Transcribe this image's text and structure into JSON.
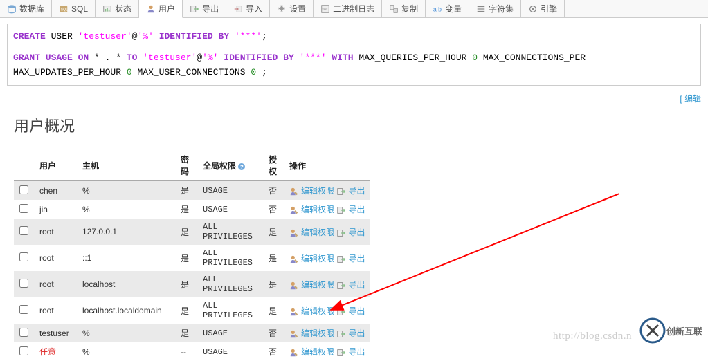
{
  "tabs": [
    {
      "label": "数据库",
      "icon": "database-icon"
    },
    {
      "label": "SQL",
      "icon": "sql-icon"
    },
    {
      "label": "状态",
      "icon": "status-icon"
    },
    {
      "label": "用户",
      "icon": "users-icon",
      "active": true
    },
    {
      "label": "导出",
      "icon": "export-icon"
    },
    {
      "label": "导入",
      "icon": "import-icon"
    },
    {
      "label": "设置",
      "icon": "settings-icon"
    },
    {
      "label": "二进制日志",
      "icon": "binlog-icon"
    },
    {
      "label": "复制",
      "icon": "replication-icon"
    },
    {
      "label": "变量",
      "icon": "variables-icon"
    },
    {
      "label": "字符集",
      "icon": "charset-icon"
    },
    {
      "label": "引擎",
      "icon": "engine-icon"
    }
  ],
  "sql": {
    "create_kw": "CREATE",
    "user_kw": "USER",
    "user_str": "'testuser'",
    "at": "@",
    "host_str": "'%'",
    "identified_by": "IDENTIFIED BY",
    "pwd_str": "'***'",
    "grant_kw": "GRANT USAGE ON",
    "star": " * . * ",
    "to_kw": "TO",
    "with_kw": "WITH",
    "max_q": "MAX_QUERIES_PER_HOUR",
    "max_c": "MAX_CONNECTIONS_PER",
    "max_u": "MAX_UPDATES_PER_HOUR",
    "max_uc": "MAX_USER_CONNECTIONS",
    "zero": "0",
    "semicolon": ";"
  },
  "edit_link": "[ 编辑",
  "section_title": "用户概况",
  "headers": {
    "user": "用户",
    "host": "主机",
    "password": "密码",
    "global_priv": "全局权限",
    "grant": "授权",
    "actions": "操作"
  },
  "action_labels": {
    "edit_priv": "编辑权限",
    "export": "导出"
  },
  "users": [
    {
      "user": "chen",
      "host": "%",
      "password": "是",
      "priv": "USAGE",
      "grant": "否"
    },
    {
      "user": "jia",
      "host": "%",
      "password": "是",
      "priv": "USAGE",
      "grant": "否"
    },
    {
      "user": "root",
      "host": "127.0.0.1",
      "password": "是",
      "priv": "ALL PRIVILEGES",
      "grant": "是"
    },
    {
      "user": "root",
      "host": "::1",
      "password": "是",
      "priv": "ALL PRIVILEGES",
      "grant": "是"
    },
    {
      "user": "root",
      "host": "localhost",
      "password": "是",
      "priv": "ALL PRIVILEGES",
      "grant": "是"
    },
    {
      "user": "root",
      "host": "localhost.localdomain",
      "password": "是",
      "priv": "ALL PRIVILEGES",
      "grant": "是"
    },
    {
      "user": "testuser",
      "host": "%",
      "password": "是",
      "priv": "USAGE",
      "grant": "否"
    },
    {
      "user": "任意",
      "host": "%",
      "password": "--",
      "priv": "USAGE",
      "grant": "否",
      "any": true
    }
  ],
  "watermark": "http://blog.csdn.n",
  "logo_text": "创新互联"
}
